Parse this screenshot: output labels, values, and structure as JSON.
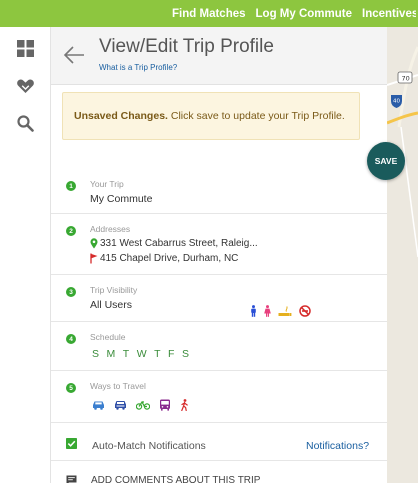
{
  "topnav": {
    "items": [
      "Find Matches",
      "Log My Commute",
      "Incentives"
    ]
  },
  "header": {
    "title": "View/Edit Trip Profile",
    "help_link": "What is a Trip Profile?"
  },
  "alert": {
    "strong": "Unsaved Changes.",
    "text": " Click save to update your Trip Profile."
  },
  "save_label": "SAVE",
  "sections": {
    "trip": {
      "step": "1",
      "label": "Your Trip",
      "value": "My Commute"
    },
    "addresses": {
      "step": "2",
      "label": "Addresses",
      "origin": "331 West Cabarrus Street, Raleig...",
      "destination": "415 Chapel Drive, Durham, NC"
    },
    "visibility": {
      "step": "3",
      "label": "Trip Visibility",
      "value": "All Users"
    },
    "schedule": {
      "step": "4",
      "label": "Schedule",
      "days": [
        "S",
        "M",
        "T",
        "W",
        "T",
        "F",
        "S"
      ]
    },
    "travel": {
      "step": "5",
      "label": "Ways to Travel"
    }
  },
  "notifications": {
    "label": "Auto-Match Notifications",
    "link": "Notifications?"
  },
  "comments": {
    "label": "ADD COMMENTS ABOUT THIS TRIP"
  },
  "colors": {
    "topbar": "#8dc63f",
    "accent_green": "#38a832",
    "save_button": "#1a5b5c",
    "link": "#1a5fa0",
    "alert_bg": "#fcf5e0"
  },
  "icons": {
    "rail": [
      "grid-icon",
      "heart-match-icon",
      "search-icon"
    ],
    "visibility": [
      "male-icon",
      "female-icon",
      "smoking-icon",
      "no-smoking-icon"
    ],
    "travel": [
      "car-icon",
      "carpool-icon",
      "bike-icon",
      "bus-icon",
      "walk-icon"
    ]
  }
}
